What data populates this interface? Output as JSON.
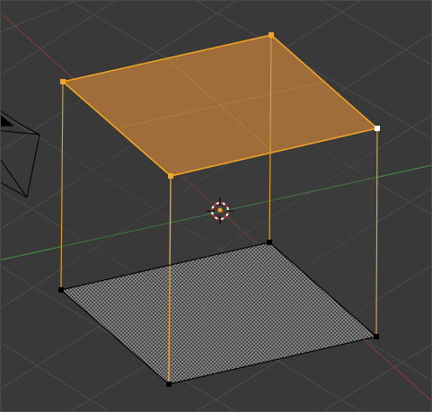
{
  "viewport": {
    "type": "3d-viewport",
    "background": "#393939",
    "grid_color": "#4c4c4c",
    "axis_x_color": "#8b3a3a",
    "axis_y_color": "#3f9b3f"
  },
  "scene": {
    "objects": [
      {
        "name": "Cube",
        "mode": "edit",
        "selected_face": "top",
        "selection_color": "#f5a623",
        "unselected_vertex_color": "#000000",
        "active_vertex_color": "#ffffff"
      },
      {
        "name": "Camera",
        "icon": "camera-wireframe-icon"
      }
    ],
    "cursor_3d": {
      "icon": "3d-cursor-icon"
    }
  }
}
